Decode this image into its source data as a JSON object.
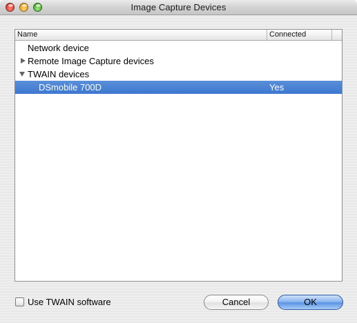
{
  "window": {
    "title": "Image Capture Devices"
  },
  "table": {
    "columns": {
      "name": "Name",
      "connected": "Connected"
    },
    "rows": [
      {
        "name": "Network device",
        "connected": ""
      },
      {
        "name": "Remote Image Capture devices",
        "connected": "",
        "disclosure": "collapsed"
      },
      {
        "name": "TWAIN devices",
        "connected": "",
        "disclosure": "expanded"
      },
      {
        "name": "DSmobile 700D",
        "connected": "Yes",
        "selected": true
      }
    ]
  },
  "options": {
    "use_twain_label": "Use TWAIN software",
    "use_twain_checked": false
  },
  "buttons": {
    "cancel_label": "Cancel",
    "ok_label": "OK"
  },
  "colors": {
    "selection": "#3d78d0",
    "default_button": "#5c95e4",
    "close": "#e0443a",
    "minimize": "#eda82a",
    "zoom": "#57b53a"
  },
  "icons": {
    "close": "close-icon",
    "minimize": "minimize-icon",
    "zoom": "zoom-icon",
    "collapsed": "disclosure-triangle-right-icon",
    "expanded": "disclosure-triangle-down-icon"
  }
}
